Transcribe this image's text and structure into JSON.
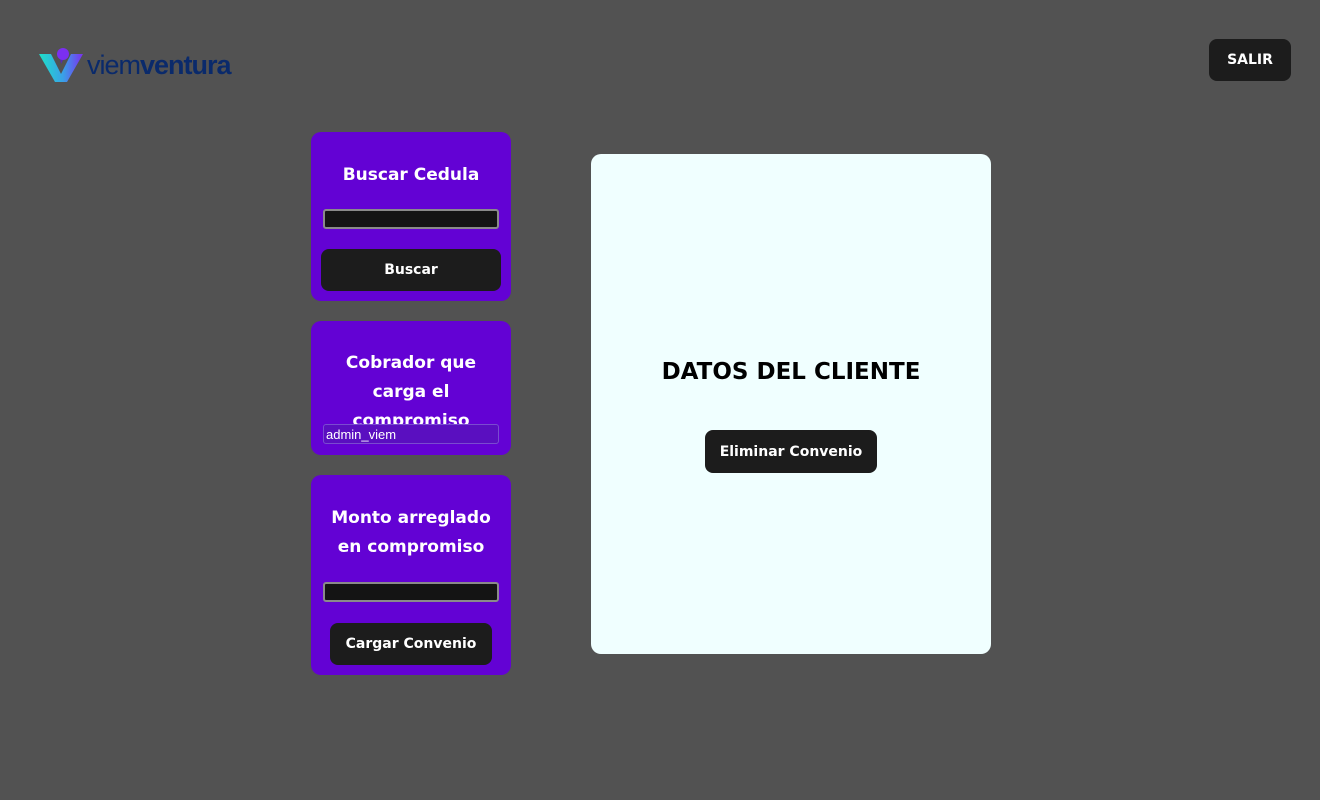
{
  "brand": {
    "name_light": "viem",
    "name_bold": "ventura",
    "colors": {
      "accent_purple": "#6302d4",
      "logo_cyan": "#1ee0c8",
      "logo_navy": "#0a2a6b"
    }
  },
  "header": {
    "logout_label": "SALIR"
  },
  "search_card": {
    "title": "Buscar Cedula",
    "input_value": "",
    "button_label": "Buscar"
  },
  "collector_card": {
    "title": "Cobrador que carga el compromiso",
    "input_value": "admin_viem"
  },
  "amount_card": {
    "title": "Monto arreglado en compromiso",
    "input_value": "",
    "button_label": "Cargar Convenio"
  },
  "client_panel": {
    "title": "DATOS DEL CLIENTE",
    "delete_button_label": "Eliminar Convenio"
  }
}
